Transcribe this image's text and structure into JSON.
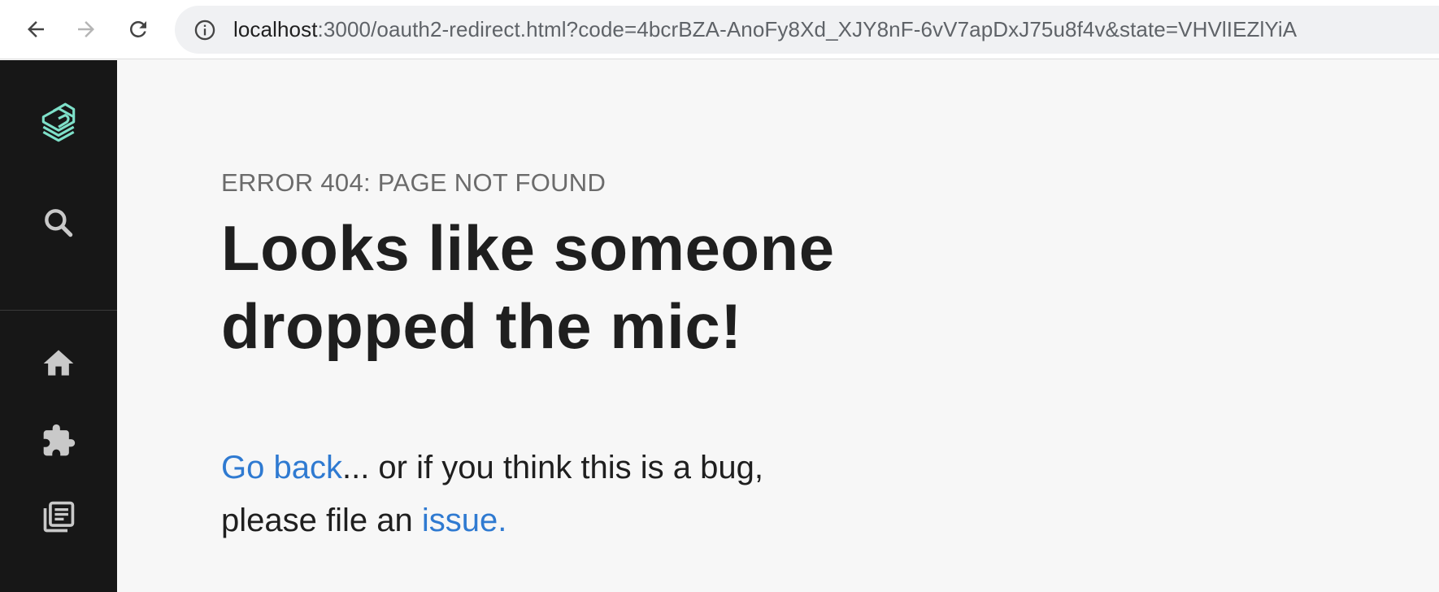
{
  "browser": {
    "url_host": "localhost",
    "url_rest": ":3000/oauth2-redirect.html?code=4bcrBZA-AnoFy8Xd_XJY8nF-6vV7apDxJ75u8f4v&state=VHVlIEZlYiA"
  },
  "sidebar": {
    "icons": [
      "logo-icon",
      "search-icon",
      "home-icon",
      "puzzle-icon",
      "docs-icon"
    ],
    "logo_color": "#7ee0c9"
  },
  "error": {
    "code_text": "ERROR 404: PAGE NOT FOUND",
    "headline_line1": "Looks like someone",
    "headline_line2": "dropped the mic!",
    "go_back_link": "Go back",
    "message_part1": "... or if you think this is a bug,",
    "message_part2": "please file an ",
    "issue_link": "issue."
  },
  "colors": {
    "link": "#2f7ad1",
    "sidebar_bg": "#171717",
    "page_bg": "#f7f7f7"
  }
}
